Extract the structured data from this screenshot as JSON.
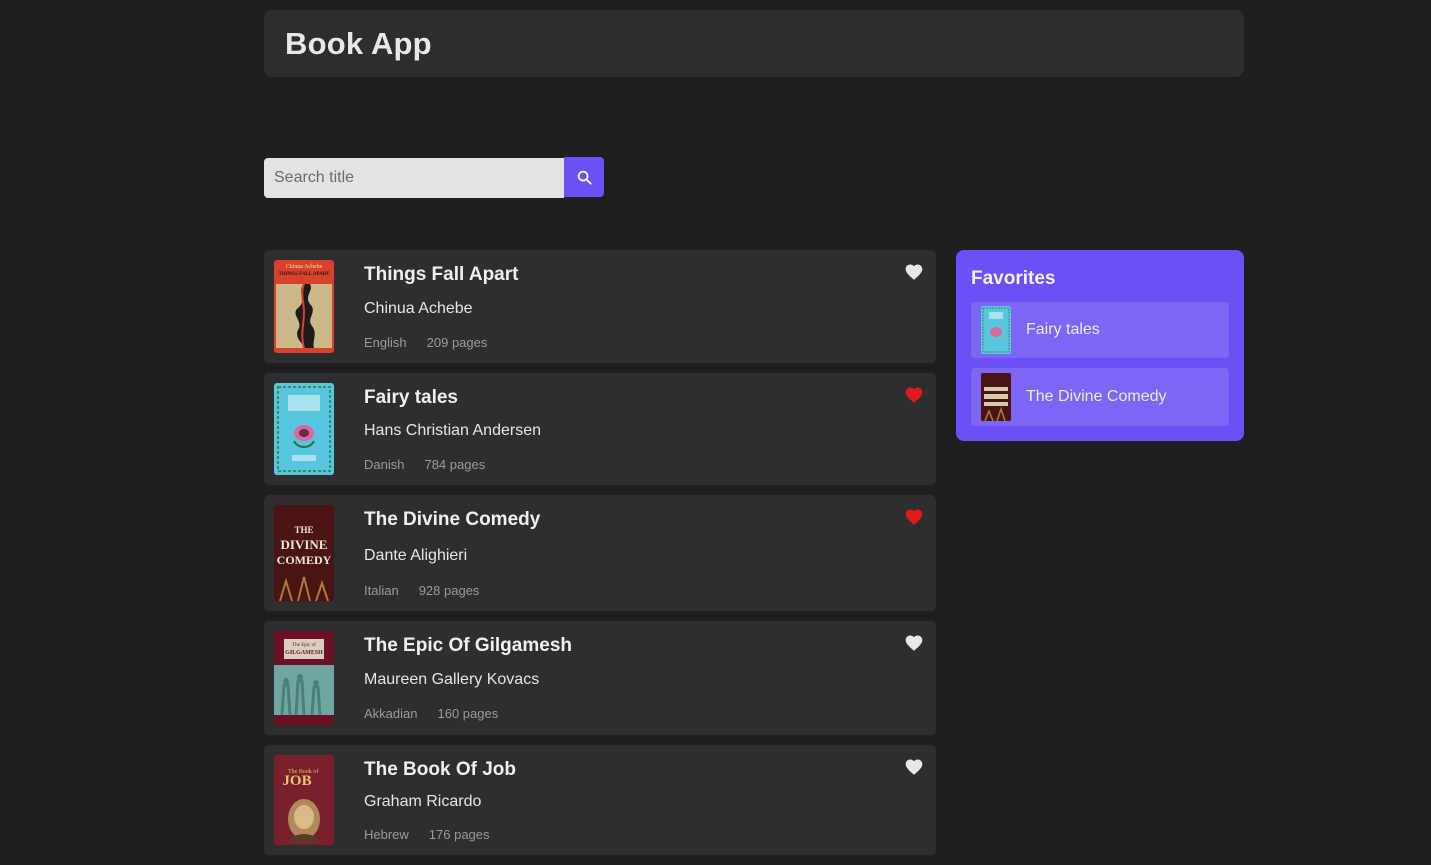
{
  "header": {
    "title": "Book App"
  },
  "search": {
    "placeholder": "Search title",
    "value": "",
    "button_icon": "search-icon"
  },
  "books": [
    {
      "title": "Things Fall Apart",
      "author": "Chinua Achebe",
      "language": "English",
      "pages": "209 pages",
      "favorite": false
    },
    {
      "title": "Fairy tales",
      "author": "Hans Christian Andersen",
      "language": "Danish",
      "pages": "784 pages",
      "favorite": true
    },
    {
      "title": "The Divine Comedy",
      "author": "Dante Alighieri",
      "language": "Italian",
      "pages": "928 pages",
      "favorite": true
    },
    {
      "title": "The Epic Of Gilgamesh",
      "author": "Maureen Gallery Kovacs",
      "language": "Akkadian",
      "pages": "160 pages",
      "favorite": false
    },
    {
      "title": "The Book Of Job",
      "author": "Graham Ricardo",
      "language": "Hebrew",
      "pages": "176 pages",
      "favorite": false
    }
  ],
  "covers": {
    "things_fall_apart": {
      "line1": "Chinua Achebe",
      "line2": "THINGS FALL APART"
    },
    "divine": {
      "line1": "THE",
      "line2": "DIVINE",
      "line3": "COMEDY"
    },
    "gilgamesh": {
      "line1": "The Epic of",
      "line2": "GILGAMESH"
    },
    "job": {
      "line1": "The Book of",
      "line2": "JOB"
    }
  },
  "favorites": {
    "title": "Favorites",
    "items": [
      {
        "label": "Fairy tales"
      },
      {
        "label": "The Divine Comedy"
      }
    ]
  },
  "colors": {
    "accent": "#6c4ff5",
    "heart_active": "#e0191b",
    "heart_inactive": "#e8e8e8"
  }
}
